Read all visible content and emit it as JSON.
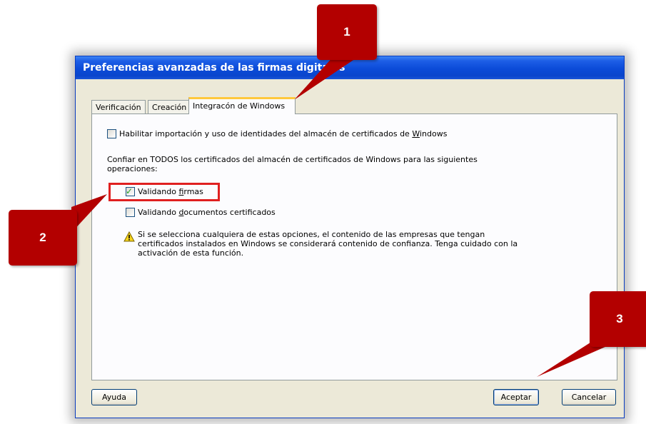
{
  "dialog": {
    "title": "Preferencias avanzadas de las firmas digitales",
    "tabs": [
      {
        "label": "Verificación",
        "active": false
      },
      {
        "label": "Creación",
        "active": false
      },
      {
        "label": "Integracón de Windows",
        "active": true
      }
    ],
    "enable_import": {
      "checked": false,
      "label_before": "Habilitar importación y uso de identidades del almacén de certificados de ",
      "label_underlined": "W",
      "label_after": "indows"
    },
    "trust_text_line1": "Confiar en TODOS los certificados del almacén de certificados de Windows para las siguientes",
    "trust_text_line2": "operaciones:",
    "validate_signatures": {
      "checked": true,
      "label_before": "Validando ",
      "label_underlined": "f",
      "label_after": "irmas"
    },
    "validate_documents": {
      "checked": false,
      "label_before": "Validando ",
      "label_underlined": "d",
      "label_after": "ocumentos certificados"
    },
    "warning": {
      "icon": "warning-triangle-icon",
      "line1": "Si se selecciona cualquiera de estas opciones, el contenido de las empresas que tengan",
      "line2": "certificados instalados en Windows se considerará contenido de confianza. Tenga cuidado con la",
      "line3": "activación de esta función."
    },
    "buttons": {
      "help": "Ayuda",
      "accept": "Aceptar",
      "cancel": "Cancelar"
    }
  },
  "callouts": [
    {
      "label": "1"
    },
    {
      "label": "2"
    },
    {
      "label": "3"
    }
  ],
  "colors": {
    "callout": "#b30000",
    "highlight": "#e02020",
    "titlebar": "#0b4bd8",
    "dialog_bg": "#ece9d8",
    "active_tab_accent": "#ffc83c"
  }
}
